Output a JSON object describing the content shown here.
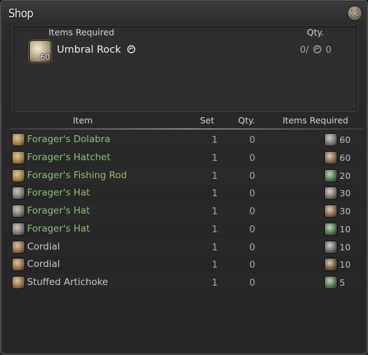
{
  "window": {
    "title": "Shop"
  },
  "requirements": {
    "items_header": "Items Required",
    "qty_header": "Qty.",
    "item": {
      "name": "Umbral Rock",
      "count": "60",
      "owned": "0/",
      "needed": "0",
      "icon": "umbral-rock-icon"
    }
  },
  "table": {
    "headers": {
      "item": "Item",
      "set": "Set",
      "qty": "Qty.",
      "items_required": "Items Required"
    },
    "rows": [
      {
        "name": "Forager's Dolabra",
        "set": "1",
        "qty": "0",
        "cost": "60",
        "icon": "pickaxe-icon",
        "cost_icon": "rock-icon",
        "highlight": true,
        "icon_color": "#9a7a3c",
        "cost_color": "#7a766e"
      },
      {
        "name": "Forager's Hatchet",
        "set": "1",
        "qty": "0",
        "cost": "60",
        "icon": "hatchet-icon",
        "cost_icon": "rock-icon",
        "highlight": true,
        "icon_color": "#9a7a3c",
        "cost_color": "#8a6a44"
      },
      {
        "name": "Forager's Fishing Rod",
        "set": "1",
        "qty": "0",
        "cost": "20",
        "icon": "fishing-rod-icon",
        "cost_icon": "rock-icon",
        "highlight": true,
        "icon_color": "#9a7a3c",
        "cost_color": "#4d7a4a"
      },
      {
        "name": "Forager's Hat",
        "set": "1",
        "qty": "0",
        "cost": "30",
        "icon": "hat-icon",
        "cost_icon": "rock-icon",
        "highlight": true,
        "icon_color": "#6c7378",
        "cost_color": "#7a766e"
      },
      {
        "name": "Forager's Hat",
        "set": "1",
        "qty": "0",
        "cost": "30",
        "icon": "hat-icon",
        "cost_icon": "rock-icon",
        "highlight": true,
        "icon_color": "#6c7378",
        "cost_color": "#8a6a44"
      },
      {
        "name": "Forager's Hat",
        "set": "1",
        "qty": "0",
        "cost": "10",
        "icon": "hat-icon",
        "cost_icon": "rock-icon",
        "highlight": true,
        "icon_color": "#6c7378",
        "cost_color": "#4d7a4a"
      },
      {
        "name": "Cordial",
        "set": "1",
        "qty": "0",
        "cost": "10",
        "icon": "potion-icon",
        "cost_icon": "rock-icon",
        "highlight": false,
        "icon_color": "#8a6a44",
        "cost_color": "#6a6a6a"
      },
      {
        "name": "Cordial",
        "set": "1",
        "qty": "0",
        "cost": "10",
        "icon": "potion-icon",
        "cost_icon": "rock-icon",
        "highlight": false,
        "icon_color": "#8a6a44",
        "cost_color": "#7a5a3a"
      },
      {
        "name": "Stuffed Artichoke",
        "set": "1",
        "qty": "0",
        "cost": "5",
        "icon": "cutlery-icon",
        "cost_icon": "leaf-icon",
        "highlight": false,
        "icon_color": "#8a6a44",
        "cost_color": "#4d7a4a"
      }
    ]
  },
  "colors": {
    "highlight_text": "#8fbf78",
    "plain_text": "#c8c8c8",
    "muted_text": "#a8a8a8"
  }
}
